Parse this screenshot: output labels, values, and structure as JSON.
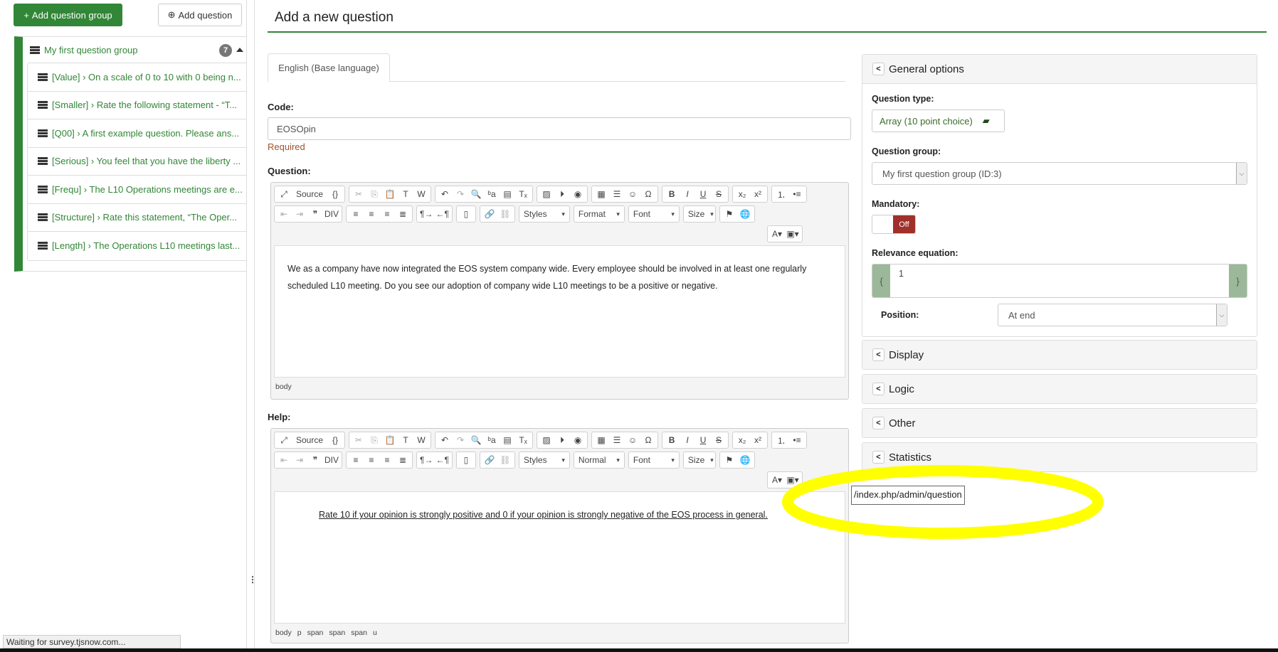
{
  "sidebar": {
    "add_group_label": "Add question group",
    "add_question_label": "Add question",
    "group": {
      "name": "My first question group",
      "count": "7",
      "questions": [
        "[Value] › On a scale of 0 to 10 with 0 being n...",
        "[Smaller] › Rate the following statement - “T...",
        "[Q00] › A first example question. Please ans...",
        "[Serious] › You feel that you have the liberty ...",
        "[Frequ] › The L10 Operations meetings are e...",
        "[Structure] › Rate this statement, “The Oper...",
        "[Length] › The Operations L10 meetings last..."
      ]
    }
  },
  "main": {
    "title": "Add a new question",
    "tab": "English (Base language)",
    "code_label": "Code:",
    "code_value": "EOSOpin",
    "required": "Required",
    "question_label": "Question:",
    "question_text": "We as a company have now integrated the EOS system company wide.   Every employee should be involved in at least one regularly scheduled L10 meeting.   Do you see our adoption of company wide L10 meetings to be a positive or negative.",
    "question_path": [
      "body"
    ],
    "help_label": "Help:",
    "help_text": "Rate 10 if your opinion is strongly positive and 0 if your opinion is strongly negative of the EOS process in general.",
    "help_path": [
      "body",
      "p",
      "span",
      "span",
      "span",
      "u"
    ],
    "toolbar": {
      "source_label": "Source",
      "question_combos": [
        "Styles",
        "Format",
        "Font",
        "Size"
      ],
      "help_combos": [
        "Styles",
        "Normal",
        "Font",
        "Size"
      ]
    }
  },
  "right": {
    "general_title": "General options",
    "question_type_label": "Question type:",
    "question_type_value": "Array (10 point choice)",
    "question_group_label": "Question group:",
    "question_group_value": "My first question group (ID:3)",
    "mandatory_label": "Mandatory:",
    "mandatory_value": "Off",
    "relevance_label": "Relevance equation:",
    "relevance_value": "1",
    "position_label": "Position:",
    "position_value": "At end",
    "sections": [
      "Display",
      "Logic",
      "Other",
      "Statistics"
    ]
  },
  "tooltip": "/index.php/admin/question",
  "status_text": "Waiting for survey.tjsnow.com...",
  "colors": {
    "brand": "#328637",
    "danger": "#a0302a",
    "highlight": "#ffff00"
  }
}
